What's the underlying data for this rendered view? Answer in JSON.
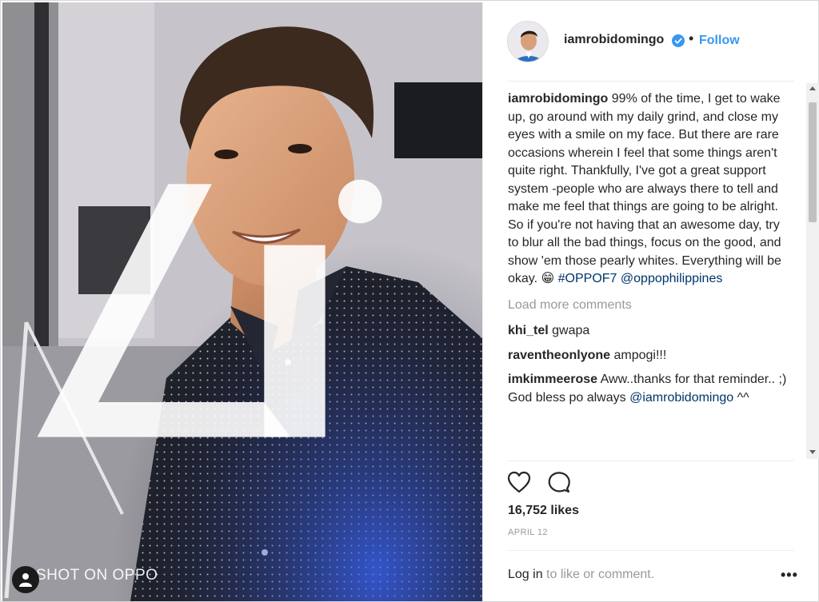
{
  "post": {
    "username": "iamrobidomingo",
    "separator": "•",
    "follow_label": "Follow",
    "caption": "99% of the time, I get to wake up, go around with my daily grind, and close my eyes with a smile on my face. But there are rare occasions wherein I feel that some things aren't quite right. Thankfully, I've got a great support system -people who are always there to tell and make me feel that things are going to be alright. So if you're not having that an awesome day, try to blur all the bad things, focus on the good, and show 'em those pearly whites. Everything will be okay. 😁",
    "hashtag": "#OPPOF7",
    "mention": "@oppophilippines",
    "load_more": "Load more comments",
    "comments": [
      {
        "user": "khi_tel",
        "text": "gwapa"
      },
      {
        "user": "raventheonlyone",
        "text": "ampogi!!!"
      },
      {
        "user": "imkimmeerose",
        "text": "Aww..thanks for that reminder.. ;) God bless po always",
        "mention": "@iamrobidomingo",
        "suffix": " ^^"
      }
    ],
    "likes": "16,752 likes",
    "date": "APRIL 12",
    "login_link": "Log in",
    "login_rest": " to like or comment.",
    "more_label": "•••"
  },
  "photo": {
    "watermark": "SHOT ON OPPO"
  },
  "colors": {
    "accent": "#3897f0",
    "verified": "#3897f0",
    "muted": "#999999",
    "text": "#262626",
    "link": "#003569"
  },
  "icons": [
    "verified-badge-icon",
    "heart-icon",
    "comment-bubble-icon",
    "user-tag-icon",
    "more-options-icon",
    "oppo-logo"
  ]
}
